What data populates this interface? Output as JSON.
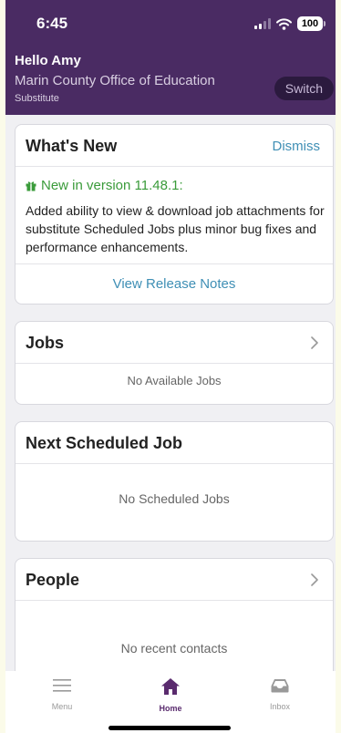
{
  "status_bar": {
    "time": "6:45",
    "battery": "100"
  },
  "header": {
    "greeting": "Hello Amy",
    "organization": "Marin County Office of Education",
    "role": "Substitute",
    "switch_label": "Switch"
  },
  "whats_new": {
    "title": "What's New",
    "dismiss_label": "Dismiss",
    "version_heading": "New in version 11.48.1:",
    "description": "Added ability to view & download job attachments for substitute Scheduled Jobs plus minor bug fixes and performance enhancements.",
    "release_notes_link": "View Release Notes"
  },
  "jobs": {
    "title": "Jobs",
    "empty_message": "No Available Jobs"
  },
  "next_scheduled_job": {
    "title": "Next Scheduled Job",
    "empty_message": "No Scheduled Jobs"
  },
  "people": {
    "title": "People",
    "empty_message": "No recent contacts"
  },
  "tab_bar": {
    "active_color": "#5a2b6e",
    "items": [
      {
        "label": "Menu",
        "icon": "menu-icon"
      },
      {
        "label": "Home",
        "icon": "home-icon"
      },
      {
        "label": "Inbox",
        "icon": "inbox-icon"
      }
    ]
  },
  "colors": {
    "header_background": "#4a2b63",
    "link": "#3f8fb5",
    "new_version": "#3a9b3a"
  }
}
